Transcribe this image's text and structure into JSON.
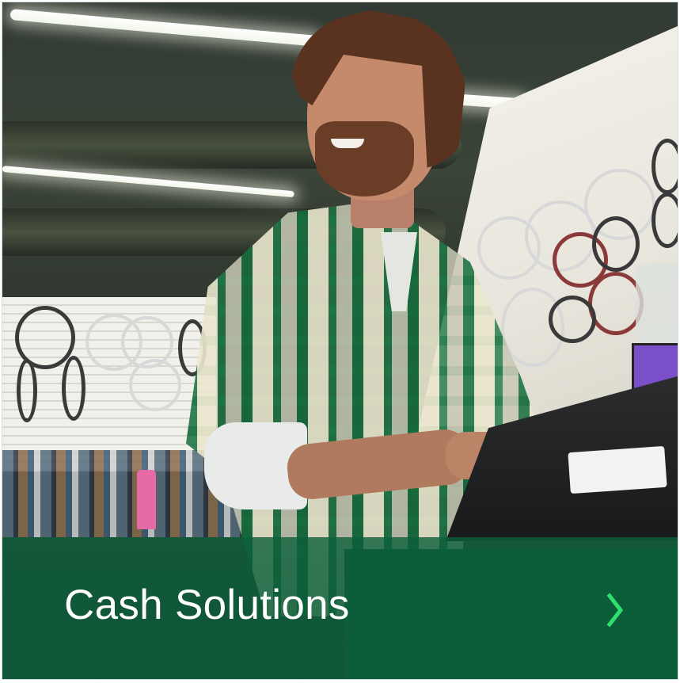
{
  "card": {
    "title": "Cash Solutions",
    "link_icon": "chevron-right-icon"
  },
  "colors": {
    "band": "#0c5f3a",
    "title_text": "#ffffff",
    "chevron": "#2ee06e"
  }
}
